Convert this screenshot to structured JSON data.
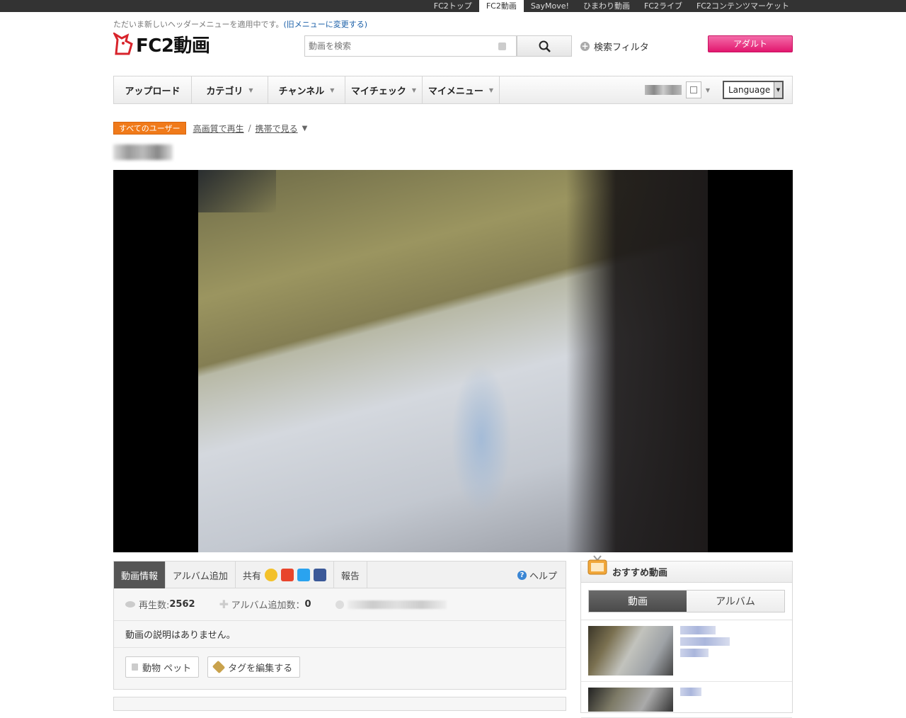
{
  "topbar": {
    "links": [
      "FC2トップ",
      "FC2動画",
      "SayMove!",
      "ひまわり動画",
      "FC2ライブ",
      "FC2コンテンツマーケット"
    ],
    "active_index": 1
  },
  "header": {
    "notice": "ただいま新しいヘッダーメニューを適用中です。",
    "notice_link": "(旧メニューに変更する)",
    "logo_text": "FC2動画",
    "search_placeholder": "動画を検索",
    "search_filter": "検索フィルタ",
    "adult_button": "アダルト"
  },
  "nav": {
    "items": [
      {
        "label": "アップロード",
        "dropdown": false
      },
      {
        "label": "カテゴリ",
        "dropdown": true
      },
      {
        "label": "チャンネル",
        "dropdown": true
      },
      {
        "label": "マイチェック",
        "dropdown": true
      },
      {
        "label": "マイメニュー",
        "dropdown": true
      }
    ],
    "language": "Language"
  },
  "breadcrumb": {
    "badge": "すべてのユーザー",
    "hq_link": "高画質で再生",
    "separator": "/",
    "mobile_link": "携帯で見る",
    "more": "▼"
  },
  "info": {
    "tabs": {
      "info": "動画情報",
      "album_add": "アルバム追加",
      "share": "共有",
      "report": "報告",
      "help": "ヘルプ"
    },
    "stats": {
      "plays_label": "再生数:",
      "plays_value": "2562",
      "album_label": "アルバム追加数：",
      "album_value": "0"
    },
    "description": "動画の説明はありません。",
    "tags": [
      "動物 ペット",
      "タグを編集する"
    ]
  },
  "recommend": {
    "title": "おすすめ動画",
    "tabs": [
      "動画",
      "アルバム"
    ],
    "active_tab": 0
  },
  "colors": {
    "topbar": "#333333",
    "adult": "#e2176e",
    "badge": "#f07a1a",
    "help": "#3a86d4"
  }
}
